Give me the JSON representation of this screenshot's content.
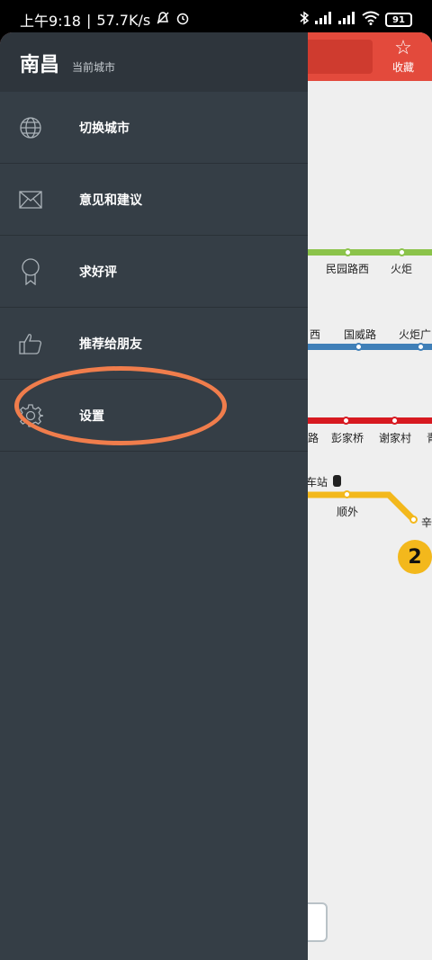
{
  "status_bar": {
    "time": "上午9:18",
    "speed": "57.7K/s",
    "battery": "91"
  },
  "drawer": {
    "city_name": "南昌",
    "city_sub": "当前城市",
    "items": [
      {
        "label": "切换城市",
        "icon": "globe-icon"
      },
      {
        "label": "意见和建议",
        "icon": "envelope-icon"
      },
      {
        "label": "求好评",
        "icon": "ribbon-icon"
      },
      {
        "label": "推荐给朋友",
        "icon": "thumbs-up-icon"
      },
      {
        "label": "设置",
        "icon": "gear-icon"
      }
    ]
  },
  "background_app": {
    "favorite_label": "收藏",
    "line2_number": "2",
    "stations": {
      "s1": "民园路西",
      "s2": "火炬",
      "s3": "西",
      "s4": "国威路",
      "s5": "火炬广",
      "s6": "路",
      "s7": "彭家桥",
      "s8": "谢家村",
      "s9": "青",
      "s10": "车站",
      "s11": "顺外",
      "s12": "辛"
    },
    "colors": {
      "header": "#e34a3c",
      "line_green": "#8bc34a",
      "line_blue": "#3f7fb8",
      "line_red": "#d71920",
      "line_yellow": "#f3b81c"
    }
  },
  "annotation": {
    "color": "#f07d4c"
  }
}
